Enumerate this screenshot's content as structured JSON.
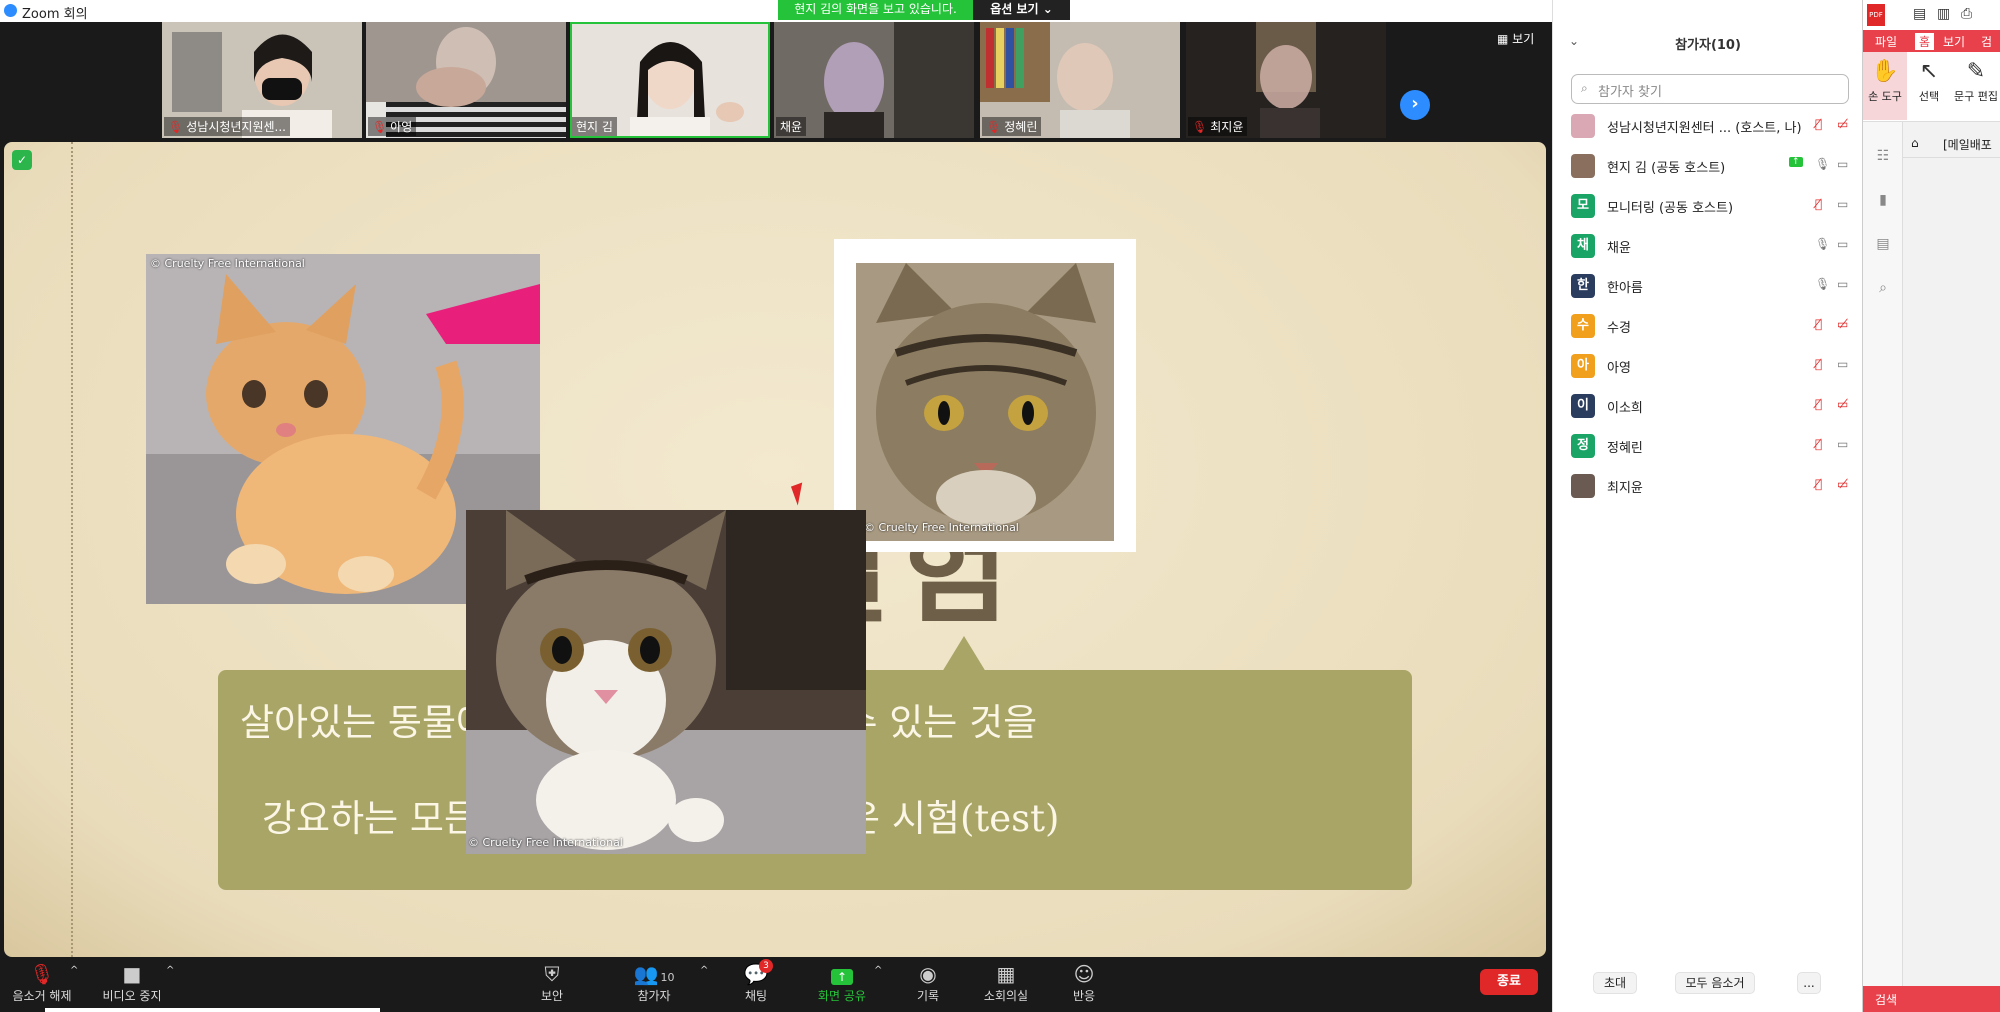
{
  "window": {
    "title": "Zoom 회의",
    "minimize": "—",
    "restore": "❐",
    "close": "✕"
  },
  "banner": {
    "text": "현지 김의 화면을 보고 있습니다.",
    "view_options": "옵션 보기 ⌄"
  },
  "strip": {
    "view_label": "▦ 보기",
    "next": "›",
    "tiles": [
      {
        "name": "성남시청년지원센...",
        "muted": true,
        "bg": "#c8c2b6"
      },
      {
        "name": "아영",
        "muted": true,
        "bg": "#9c8f86"
      },
      {
        "name": "현지 김",
        "muted": false,
        "bg": "#e0d8d0"
      },
      {
        "name": "채윤",
        "muted": false,
        "bg": "#756c66"
      },
      {
        "name": "정혜린",
        "muted": true,
        "bg": "#a8a096"
      },
      {
        "name": "최지윤",
        "muted": true,
        "bg": "#4a4440"
      }
    ]
  },
  "slide": {
    "title": "동물실험",
    "line1": "살아있는 동물에게 지속적인 해를 끼칠 수 있는 것을",
    "line2": "강요하는 모든 실험(experiment) 혹은 시험(test)",
    "credit": "© Cruelty Free International"
  },
  "toolbar": {
    "mute": "음소거 해제",
    "video": "비디오 중지",
    "security": "보안",
    "participants": "참가자",
    "participants_count": "10",
    "chat": "채팅",
    "chat_badge": "3",
    "share": "화면 공유",
    "record": "기록",
    "breakout": "소회의실",
    "reactions": "반응",
    "end": "종료"
  },
  "participants": {
    "title": "참가자(10)",
    "search_placeholder": "참가자 찾기",
    "invite": "초대",
    "mute_all": "모두 음소거",
    "more": "...",
    "items": [
      {
        "name": "성남시청년지원센터 ... (호스트, 나)",
        "avatar": "",
        "color": "#d9a8b4",
        "mic": "muted",
        "cam": "off"
      },
      {
        "name": "현지 김 (공동 호스트)",
        "avatar": "",
        "color": "#8a6f5e",
        "mic": "on",
        "cam": "on",
        "sharing": true
      },
      {
        "name": "모니터링 (공동 호스트)",
        "avatar": "모",
        "color": "#1aa566",
        "mic": "muted",
        "cam": "on"
      },
      {
        "name": "채윤",
        "avatar": "채",
        "color": "#1aa566",
        "mic": "on",
        "cam": "on"
      },
      {
        "name": "한아름",
        "avatar": "한",
        "color": "#2a3d5e",
        "mic": "on",
        "cam": "on"
      },
      {
        "name": "수경",
        "avatar": "수",
        "color": "#f0a01c",
        "mic": "muted",
        "cam": "off"
      },
      {
        "name": "아영",
        "avatar": "아",
        "color": "#f0a01c",
        "mic": "muted",
        "cam": "on"
      },
      {
        "name": "이소희",
        "avatar": "이",
        "color": "#2a3d5e",
        "mic": "muted",
        "cam": "off"
      },
      {
        "name": "정혜린",
        "avatar": "정",
        "color": "#1aa566",
        "mic": "muted",
        "cam": "on"
      },
      {
        "name": "최지윤",
        "avatar": "",
        "color": "#6b5a52",
        "mic": "muted",
        "cam": "off"
      }
    ]
  },
  "pdf": {
    "logo": "PDF",
    "menu": [
      "파일",
      "홈",
      "보기",
      "검"
    ],
    "tools": [
      {
        "label": "손 도구",
        "icon": "✋"
      },
      {
        "label": "선택",
        "icon": "↖"
      },
      {
        "label": "문구 편집",
        "icon": "✎"
      }
    ],
    "tab_label": "[메일배포",
    "search": "검색"
  },
  "colors": {
    "accent": "#2d8cff",
    "share_green": "#25c339",
    "end_red": "#e02828",
    "callout": "#a8a567",
    "pdf_red": "#e8414b"
  }
}
